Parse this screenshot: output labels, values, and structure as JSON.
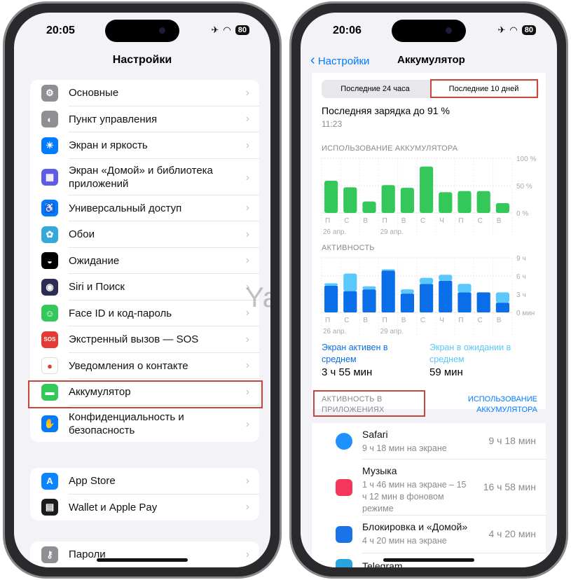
{
  "left": {
    "time": "20:05",
    "battery": "80",
    "title": "Настройки",
    "groups": [
      [
        {
          "label": "Основные",
          "icon": "gear-icon",
          "color": "#8e8e93",
          "glyph": "⚙"
        },
        {
          "label": "Пункт управления",
          "icon": "toggles-icon",
          "color": "#8e8e93",
          "glyph": "◐"
        },
        {
          "label": "Экран и яркость",
          "icon": "sun-icon",
          "color": "#007aff",
          "glyph": "☀"
        },
        {
          "label": "Экран «Домой» и библиотека приложений",
          "icon": "home-grid-icon",
          "color": "#5e5ce6",
          "glyph": "▦",
          "double": true
        },
        {
          "label": "Универсальный доступ",
          "icon": "accessibility-icon",
          "color": "#007aff",
          "glyph": "♿"
        },
        {
          "label": "Обои",
          "icon": "flower-icon",
          "color": "#34aadc",
          "glyph": "✿"
        },
        {
          "label": "Ожидание",
          "icon": "standby-icon",
          "color": "#000000",
          "glyph": "◒"
        },
        {
          "label": "Siri и Поиск",
          "icon": "siri-icon",
          "color": "#2c2c54",
          "glyph": "◉"
        },
        {
          "label": "Face ID и код-пароль",
          "icon": "face-id-icon",
          "color": "#34c759",
          "glyph": "☺"
        },
        {
          "label": "Экстренный вызов — SOS",
          "icon": "sos-icon",
          "color": "#e53935",
          "glyph": "SOS"
        },
        {
          "label": "Уведомления о контакте",
          "icon": "exposure-icon",
          "color": "#ffffff",
          "glyph": "●"
        },
        {
          "label": "Аккумулятор",
          "icon": "battery-icon",
          "color": "#34c759",
          "glyph": "▬"
        },
        {
          "label": "Конфиденциальность и безопасность",
          "icon": "hand-icon",
          "color": "#007aff",
          "glyph": "✋",
          "double": true
        }
      ],
      [
        {
          "label": "App Store",
          "icon": "app-store-icon",
          "color": "#0a84ff",
          "glyph": "A"
        },
        {
          "label": "Wallet и Apple Pay",
          "icon": "wallet-icon",
          "color": "#1c1c1e",
          "glyph": "▤"
        }
      ],
      [
        {
          "label": "Пароли",
          "icon": "key-icon",
          "color": "#8e8e93",
          "glyph": "⚷"
        }
      ]
    ]
  },
  "right": {
    "time": "20:06",
    "battery": "80",
    "back": "Настройки",
    "title": "Аккумулятор",
    "tabs": [
      "Последние 24 часа",
      "Последние 10 дней"
    ],
    "selected_tab": 1,
    "last_charge": "Последняя зарядка до 91 %",
    "last_charge_time": "11:23",
    "screen_on_label": "Экран активен в среднем",
    "screen_on_value": "3 ч 55 мин",
    "screen_off_label": "Экран в ожидании в среднем",
    "screen_off_value": "59 мин",
    "apps_header": "АКТИВНОСТЬ В ПРИЛОЖЕНИЯХ",
    "usage_link": "ИСПОЛЬЗОВАНИЕ АККУМУЛЯТОРА",
    "apps": [
      {
        "name": "Safari",
        "detail": "9 ч 18 мин на экране",
        "total": "9 ч 18 мин",
        "icon": "safari-icon",
        "color": "#1e90ff"
      },
      {
        "name": "Музыка",
        "detail": "1 ч 46 мин на экране – 15 ч 12 мин в фоновом режиме",
        "total": "16 ч 58 мин",
        "icon": "music-icon",
        "color": "#f5365c"
      },
      {
        "name": "Блокировка и «Домой»",
        "detail": "4 ч 20 мин на экране",
        "total": "4 ч 20 мин",
        "icon": "lock-home-icon",
        "color": "#1a73e8"
      },
      {
        "name": "Telegram",
        "detail": "",
        "total": "",
        "icon": "telegram-icon",
        "color": "#2aa3e0"
      }
    ]
  },
  "watermark": "Yablyk",
  "chart_data": [
    {
      "type": "bar",
      "title": "ИСПОЛЬЗОВАНИЕ АККУМУЛЯТОРА",
      "categories": [
        "П",
        "С",
        "В",
        "П",
        "В",
        "С",
        "Ч",
        "П",
        "С",
        "В"
      ],
      "date_labels": [
        "26 апр.",
        "29 апр."
      ],
      "values": [
        59,
        47,
        21,
        51,
        46,
        85,
        38,
        40,
        40,
        18
      ],
      "yticks": [
        "100 %",
        "50 %",
        "0 %"
      ],
      "ylim": [
        0,
        100
      ],
      "color": "#34c759"
    },
    {
      "type": "bar",
      "stacked": true,
      "title": "АКТИВНОСТЬ",
      "categories": [
        "П",
        "С",
        "В",
        "П",
        "В",
        "С",
        "Ч",
        "П",
        "С",
        "В"
      ],
      "date_labels": [
        "26 апр.",
        "29 апр."
      ],
      "yticks": [
        "9 ч",
        "6 ч",
        "3 ч",
        "0 мин"
      ],
      "ylim": [
        0,
        9
      ],
      "series": [
        {
          "name": "Экран активен",
          "values": [
            4.4,
            3.5,
            3.8,
            6.9,
            3.1,
            4.7,
            5.2,
            3.3,
            3.3,
            1.6
          ],
          "color": "#0a6ee8"
        },
        {
          "name": "Экран в ожидании",
          "values": [
            0.4,
            2.9,
            0.5,
            0.2,
            0.7,
            1.0,
            1.0,
            1.4,
            0,
            1.7
          ],
          "color": "#5ac8fa"
        }
      ]
    }
  ]
}
